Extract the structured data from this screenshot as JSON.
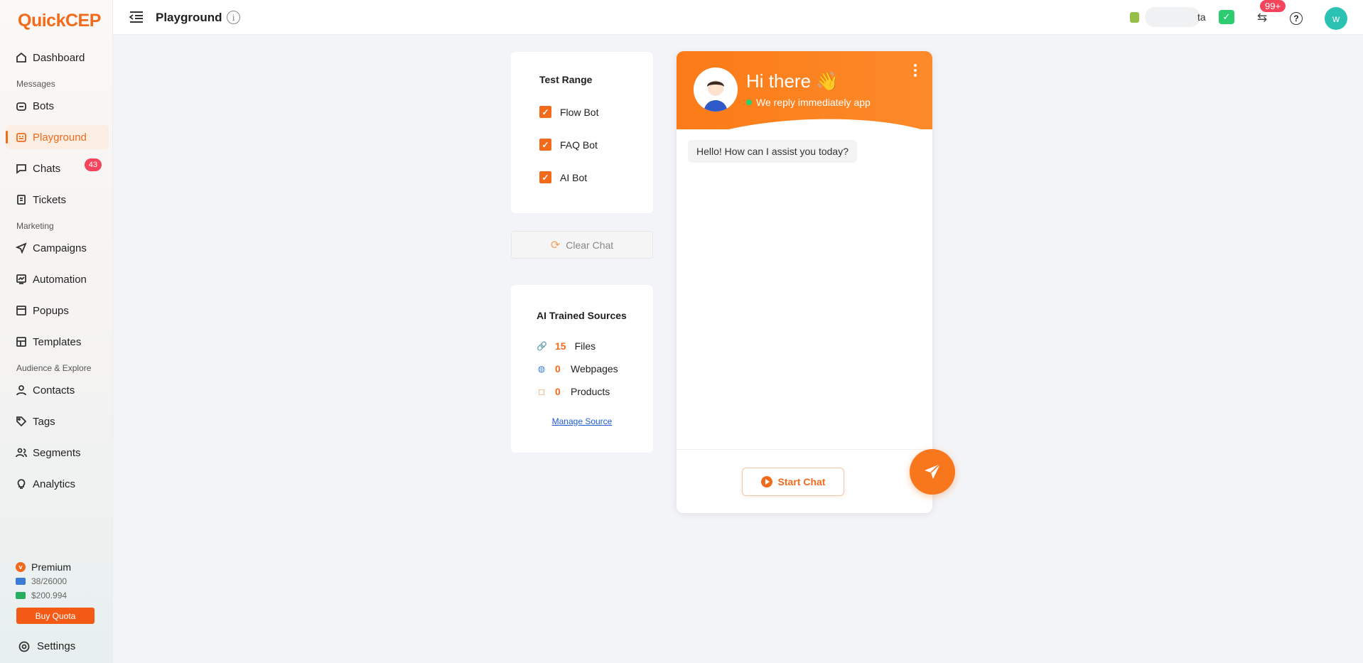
{
  "app": {
    "logo_q": "Q",
    "logo_uick": "uick",
    "logo_cep": "CEP"
  },
  "sidebar": {
    "dashboard": "Dashboard",
    "section_messages": "Messages",
    "bots": "Bots",
    "playground": "Playground",
    "chats": "Chats",
    "chats_badge": "43",
    "tickets": "Tickets",
    "section_marketing": "Marketing",
    "campaigns": "Campaigns",
    "automation": "Automation",
    "popups": "Popups",
    "templates": "Templates",
    "section_audience": "Audience & Explore",
    "contacts": "Contacts",
    "tags": "Tags",
    "segments": "Segments",
    "analytics": "Analytics"
  },
  "plan": {
    "name": "Premium",
    "emails": "38/26000",
    "balance": "$200.994",
    "buy_label": "Buy Quota"
  },
  "settings_label": "Settings",
  "topbar": {
    "title": "Playground",
    "store_name": "ta",
    "notif_badge": "99+",
    "avatar_initial": "w"
  },
  "test_range": {
    "title": "Test Range",
    "options": [
      "Flow Bot",
      "FAQ Bot",
      "AI Bot"
    ]
  },
  "clear_chat": "Clear Chat",
  "sources": {
    "title": "AI Trained Sources",
    "files_count": "15",
    "files_label": "Files",
    "webpages_count": "0",
    "webpages_label": "Webpages",
    "products_count": "0",
    "products_label": "Products",
    "manage_label": "Manage Source"
  },
  "chat": {
    "greeting": "Hi there 👋",
    "status": "We reply immediately app",
    "message": "Hello! How can I assist you today?",
    "start_label": "Start Chat"
  },
  "colors": {
    "accent": "#f26a1b",
    "online": "#29d26a",
    "badge": "#f5455c"
  }
}
